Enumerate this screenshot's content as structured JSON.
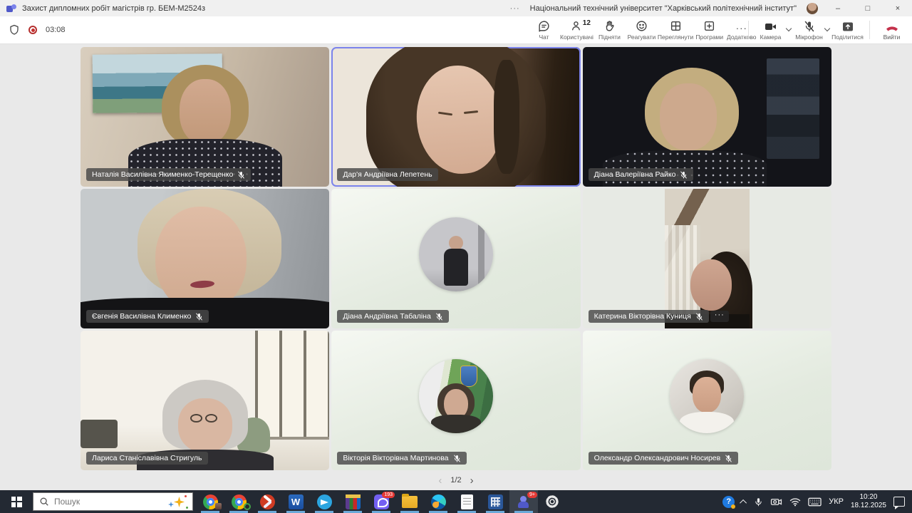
{
  "window": {
    "app_title": "Захист дипломних робіт магістрів гр. БЕМ-М2524з",
    "org_title": "Національний технічний університет \"Харківський політехнічний інститут\"",
    "title_more": "···",
    "controls": {
      "minimize": "–",
      "maximize": "□",
      "close": "×"
    }
  },
  "toolbar": {
    "timer": "03:08",
    "buttons": [
      {
        "label": "Чат",
        "icon": "chat-icon"
      },
      {
        "label": "Користувачі",
        "icon": "people-icon",
        "badge": "12"
      },
      {
        "label": "Підняти",
        "icon": "raise-hand-icon"
      },
      {
        "label": "Реагувати",
        "icon": "react-smiley-icon"
      },
      {
        "label": "Переглянути",
        "icon": "view-grid-icon"
      },
      {
        "label": "Програми",
        "icon": "apps-plus-icon"
      },
      {
        "label": "Додатково",
        "icon": "more-dots-icon",
        "glyph": "···"
      }
    ],
    "camera": {
      "label": "Камера",
      "state": "on"
    },
    "microphone": {
      "label": "Мікрофон",
      "state": "muted"
    },
    "share": {
      "label": "Поділитися"
    },
    "leave": {
      "label": "Вийти"
    },
    "colors": {
      "record_red": "#c4302f",
      "leave_red": "#c4314b"
    }
  },
  "grid": {
    "active_speaker_border": "#7b83eb",
    "tiles": [
      {
        "name": "Наталія Василівна Якименко-Терещенко",
        "muted": true,
        "type": "video"
      },
      {
        "name": "Дар'я Андріївна Лепетень",
        "muted": false,
        "type": "video",
        "active": true
      },
      {
        "name": "Діана Валеріївна Райко",
        "muted": true,
        "type": "video"
      },
      {
        "name": "Євгенія Василівна Клименко",
        "muted": true,
        "type": "video"
      },
      {
        "name": "Діана Андріївна Табаліна",
        "muted": true,
        "type": "avatar"
      },
      {
        "name": "Катерина Вікторівна Куниця",
        "muted": true,
        "type": "video",
        "more": "···"
      },
      {
        "name": "Лариса Станіславівна Стригуль",
        "muted": false,
        "type": "video"
      },
      {
        "name": "Вікторія Вікторівна Мартинова",
        "muted": true,
        "type": "avatar"
      },
      {
        "name": "Олександр Олександрович Носирев",
        "muted": true,
        "type": "avatar"
      }
    ]
  },
  "pagination": {
    "prev": "‹",
    "current": "1/2",
    "next": "›"
  },
  "taskbar": {
    "search_placeholder": "Пошук",
    "apps": [
      "chrome",
      "chrome-profile",
      "red-media-app",
      "word",
      "telegram",
      "winrar",
      "viber",
      "file-explorer",
      "edge",
      "notepad",
      "calculator",
      "teams",
      "settings"
    ],
    "icon_glyphs": {
      "word": "W",
      "help": "?"
    },
    "badges": {
      "viber": "193",
      "teams": "9+"
    },
    "tray": {
      "language": "УКР",
      "time": "10:20",
      "date": "18.12.2025"
    }
  }
}
